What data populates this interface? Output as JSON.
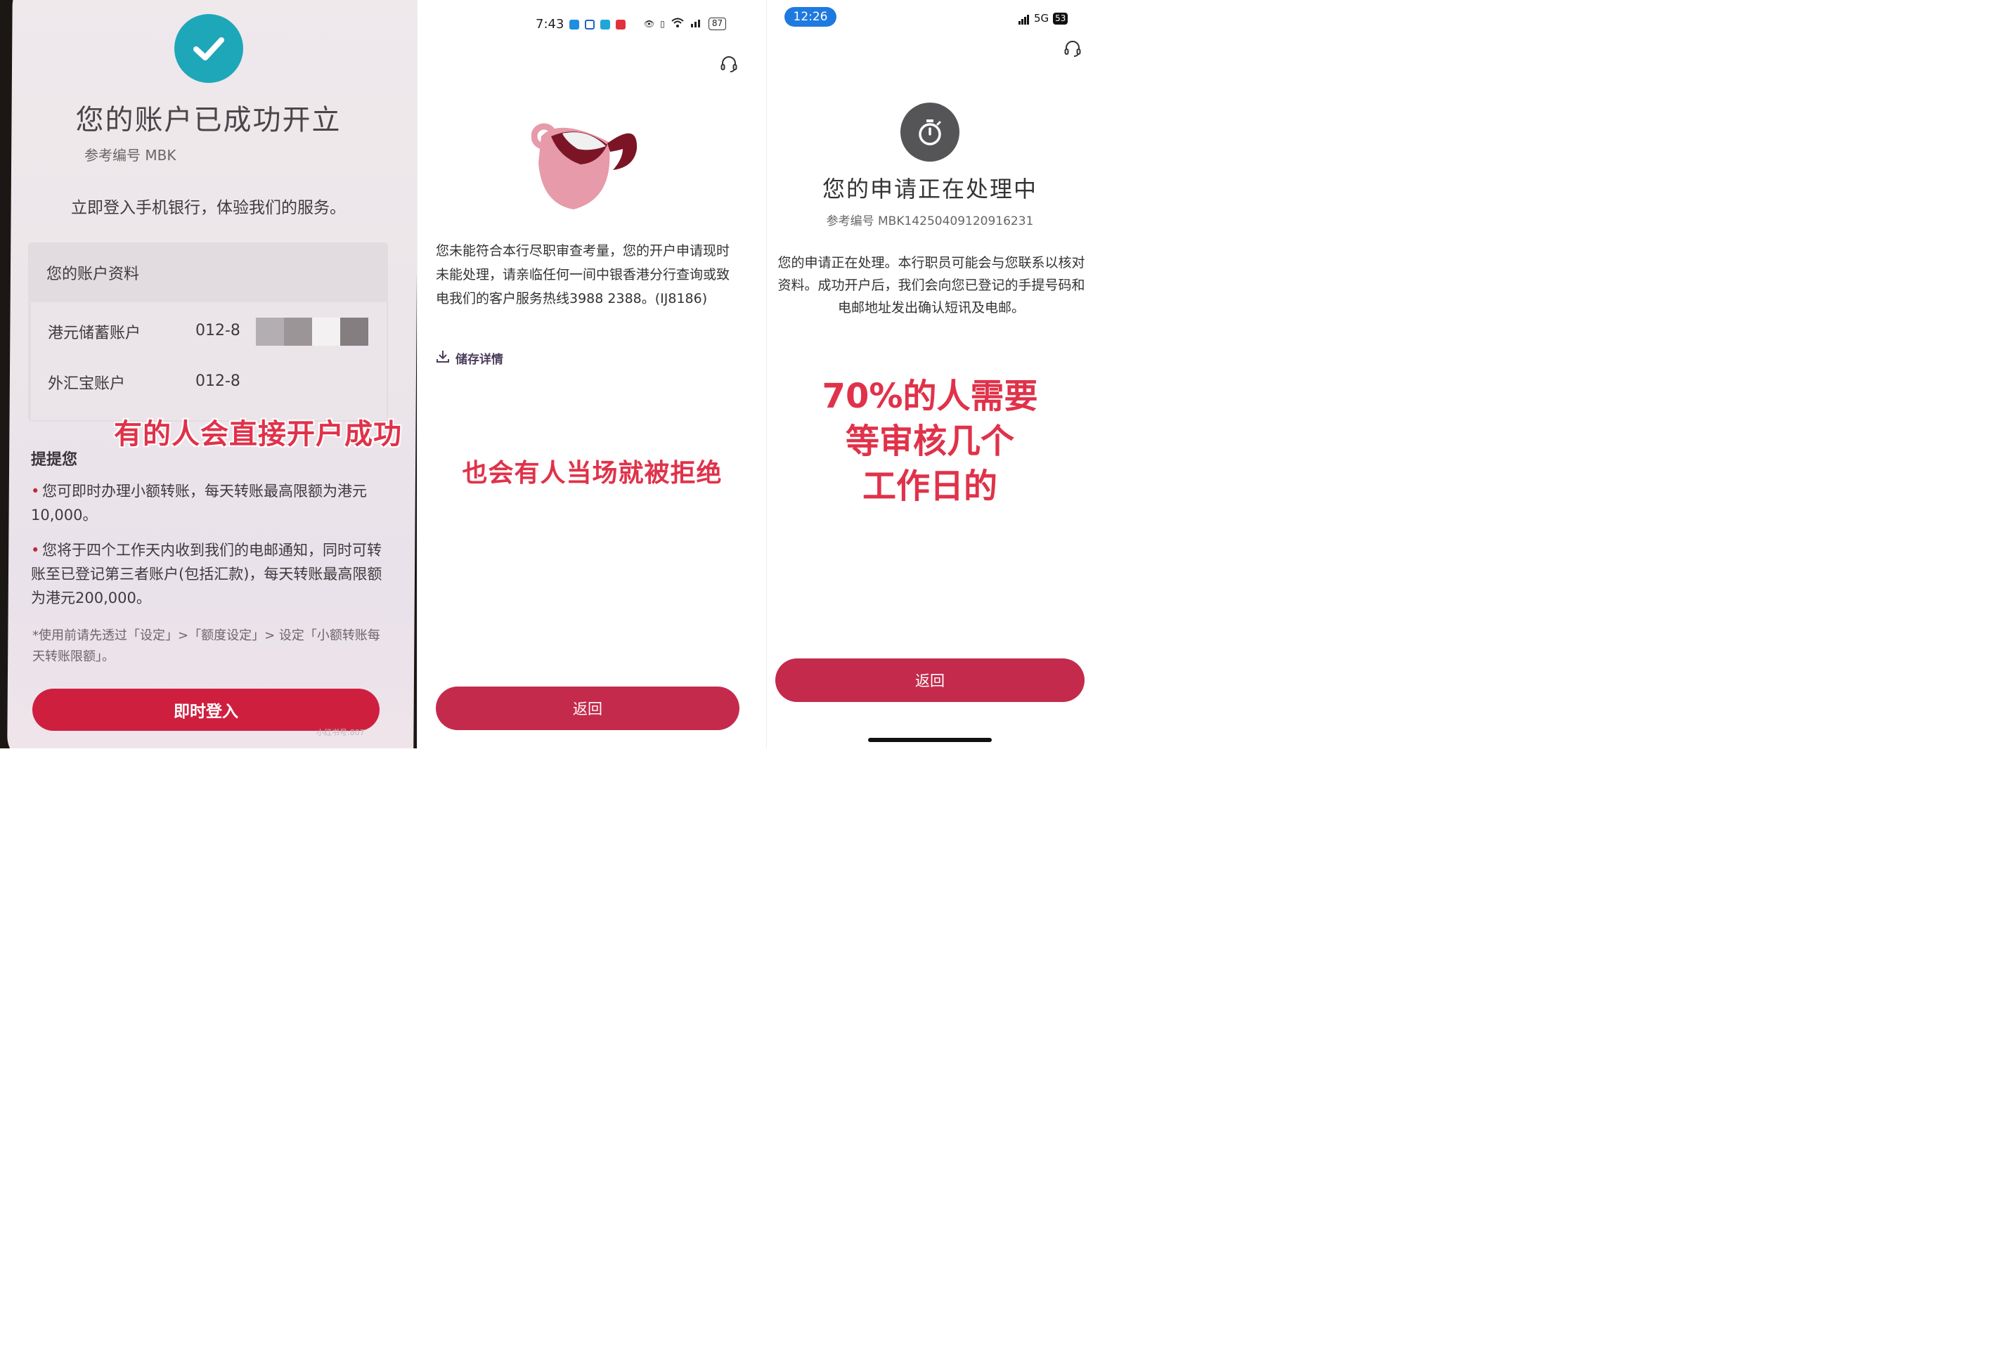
{
  "panel1": {
    "title": "您的账户已成功开立",
    "reference": "参考编号 MBK",
    "subtitle": "立即登入手机银行，体验我们的服务。",
    "account_section_title": "您的账户资料",
    "accounts": [
      {
        "label": "港元储蓄账户",
        "number": "012-8"
      },
      {
        "label": "外汇宝账户",
        "number": "012-8"
      }
    ],
    "overlay_caption": "有的人会直接开户成功",
    "reminder_title": "提提您",
    "reminders": [
      "您可即时办理小额转账，每天转账最高限额为港元10,000。",
      "您将于四个工作天内收到我们的电邮通知，同时可转账至已登记第三者账户(包括汇款)，每天转账最高限额为港元200,000。"
    ],
    "footnote": "*使用前请先透过「设定」>「额度设定」> 设定「小额转账每天转账限额」。",
    "login_button": "即时登入",
    "watermark": "小红书号:807"
  },
  "panel2": {
    "status_time": "7:43",
    "battery": "87",
    "message": "您未能符合本行尽职审查考量，您的开户申请现时未能处理，请亲临任何一间中银香港分行查询或致电我们的客户服务热线3988 2388。(IJ8186)",
    "save_details": "储存详情",
    "overlay_caption": "也会有人当场就被拒绝",
    "back_button": "返回"
  },
  "panel3": {
    "status_time": "12:26",
    "network": "5G",
    "battery": "53",
    "title": "您的申请正在处理中",
    "reference": "参考编号 MBK14250409120916231",
    "message": "您的申请正在处理。本行职员可能会与您联系以核对资料。成功开户后，我们会向您已登记的手提号码和电邮地址发出确认短讯及电邮。",
    "overlay_caption_lines": [
      "70%的人需要",
      "等审核几个",
      "工作日的"
    ],
    "back_button": "返回"
  },
  "colors": {
    "brand_red": "#c42a4c",
    "overlay_red": "#e0324a",
    "success_teal": "#1ea7b8"
  }
}
